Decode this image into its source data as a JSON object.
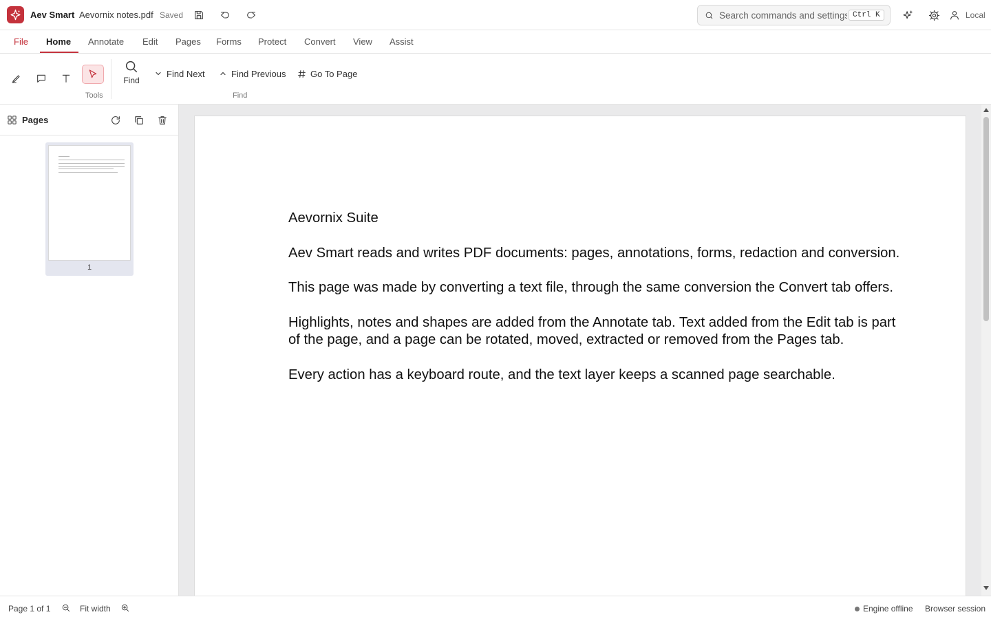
{
  "titlebar": {
    "app_name": "Aev Smart",
    "doc_name": "Aevornix notes.pdf",
    "save_status": "Saved",
    "search_placeholder": "Search commands and settings",
    "shortcut": "Ctrl K",
    "user_label": "Local"
  },
  "menu": {
    "tabs": [
      "File",
      "Home",
      "Annotate",
      "Edit",
      "Pages",
      "Forms",
      "Protect",
      "Convert",
      "View",
      "Assist"
    ],
    "active": "Home"
  },
  "ribbon": {
    "tools_group": "Tools",
    "find_label": "Find",
    "find_next": "Find Next",
    "find_previous": "Find Previous",
    "go_to_page": "Go To Page",
    "find_group": "Find"
  },
  "sidebar": {
    "title": "Pages",
    "thumbnail_page_number": "1"
  },
  "document": {
    "title": "Aevornix Suite",
    "lines": [
      "Aev Smart reads and writes PDF documents: pages, annotations, forms, redaction and conversion.",
      "This page was made by converting a text file, through the same conversion the Convert tab offers.",
      "Highlights, notes and shapes are added from the Annotate tab. Text added from the Edit tab is part",
      "of the page, and a page can be rotated, moved, extracted or removed from the Pages tab.",
      "Every action has a keyboard route, and the text layer keeps a scanned page searchable."
    ]
  },
  "statusbar": {
    "page_indicator": "Page 1 of 1",
    "zoom_mode": "Fit width",
    "engine_status": "Engine offline",
    "session": "Browser session"
  },
  "colors": {
    "accent": "#c4323c",
    "selected_tool_bg": "#fbe4e5",
    "viewer_bg": "#eaeaeb"
  }
}
